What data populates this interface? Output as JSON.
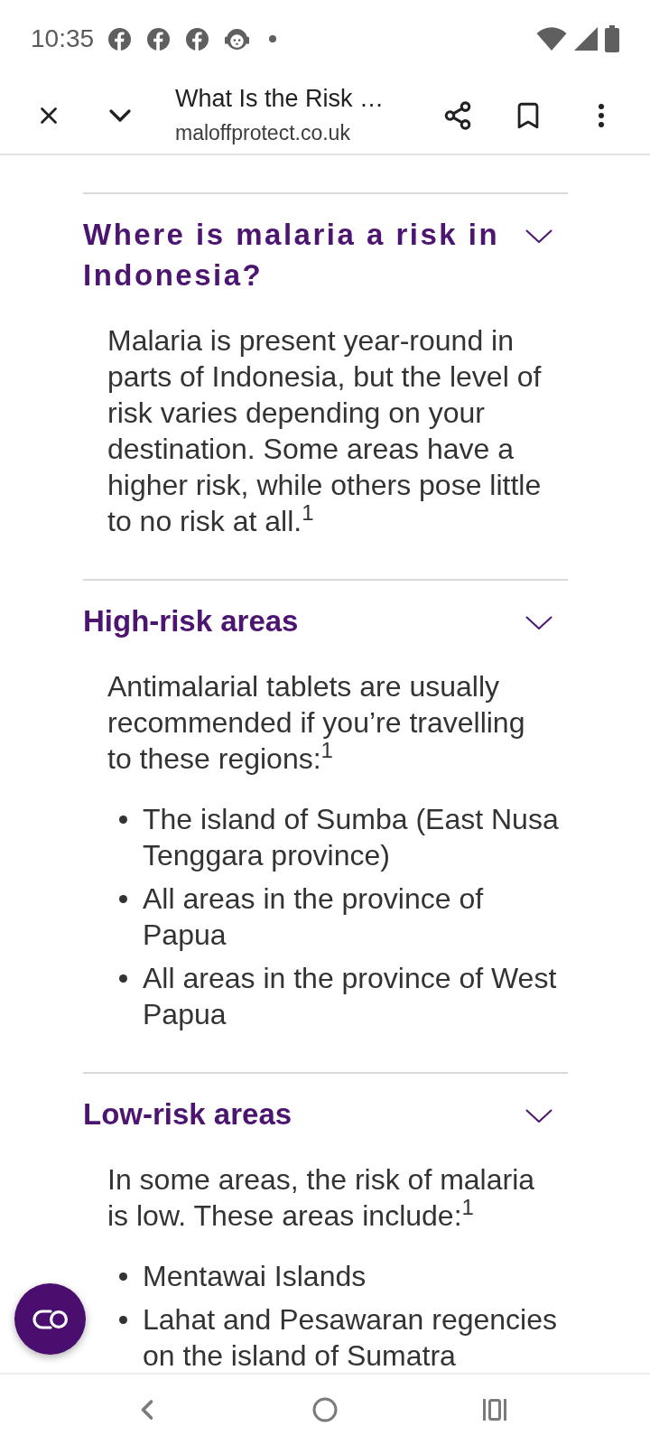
{
  "status_bar": {
    "time": "10:35"
  },
  "toolbar": {
    "title": "What Is the Risk …",
    "url": "maloffprotect.co.uk"
  },
  "sections": [
    {
      "kind": "question",
      "heading": "Where is malaria a risk in Indonesia?",
      "expanded": true,
      "text": "Malaria is present year-round in parts of Indonesia, but the level of risk varies depending on your destination. Some areas have a higher risk, while others pose little to no risk at all.$^{1}$"
    },
    {
      "kind": "area",
      "heading": "High-risk areas",
      "expanded": true,
      "text": "Antimalarial tablets are usually recommended if you’re travelling to these regions:$^{1}$",
      "items": [
        "The island of Sumba (East Nusa Tenggara province)",
        "All areas in the province of Papua",
        "All areas in the province of West Papua"
      ]
    },
    {
      "kind": "area",
      "heading": "Low-risk areas",
      "expanded": true,
      "text": "In some areas, the risk of malaria is low. These areas include:$^{1}$",
      "items": [
        "Mentawai Islands",
        "Lahat and Pesawaran regencies on the island of Sumatra"
      ]
    }
  ]
}
